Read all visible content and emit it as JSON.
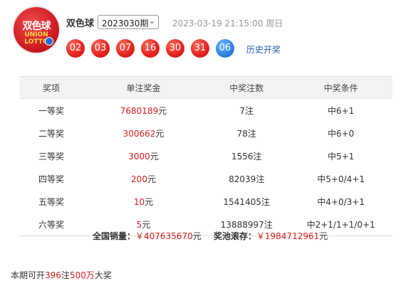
{
  "logo": {
    "cn": "双色球",
    "en1": "UNION",
    "en2": "LOTTO"
  },
  "header": {
    "title": "双色球",
    "issue": "2023030期",
    "draw_time": "2023-03-19 21:15:00 周日",
    "history_link": "历史开奖"
  },
  "balls": {
    "red": [
      "02",
      "03",
      "07",
      "16",
      "30",
      "31"
    ],
    "blue": "06"
  },
  "table": {
    "headers": [
      "奖项",
      "单注奖金",
      "中奖注数",
      "中奖条件"
    ],
    "rows": [
      {
        "level": "一等奖",
        "amount": "7680189",
        "unit": "元",
        "count": "7注",
        "cond": "中6+1"
      },
      {
        "level": "二等奖",
        "amount": "300662",
        "unit": "元",
        "count": "78注",
        "cond": "中6+0"
      },
      {
        "level": "三等奖",
        "amount": "3000",
        "unit": "元",
        "count": "1556注",
        "cond": "中5+1"
      },
      {
        "level": "四等奖",
        "amount": "200",
        "unit": "元",
        "count": "82039注",
        "cond": "中5+0/4+1"
      },
      {
        "level": "五等奖",
        "amount": "10",
        "unit": "元",
        "count": "1541405注",
        "cond": "中4+0/3+1"
      },
      {
        "level": "六等奖",
        "amount": "5",
        "unit": "元",
        "count": "13888997注",
        "cond": "中2+1/1+1/0+1"
      }
    ]
  },
  "summary": {
    "sales_label": "全国销量：",
    "sales_value": "￥407635670",
    "sales_unit": "元",
    "pool_label": "奖池滚存：",
    "pool_value": "￥1984712961",
    "pool_unit": "元"
  },
  "footer": {
    "prefix": "本期可开",
    "count": "396",
    "mid": "注",
    "amount": "500万",
    "suffix": "大奖"
  },
  "colors": {
    "red": "#d41c1c",
    "blue_ball": "#2f80e0",
    "link": "#1d5cb5"
  }
}
